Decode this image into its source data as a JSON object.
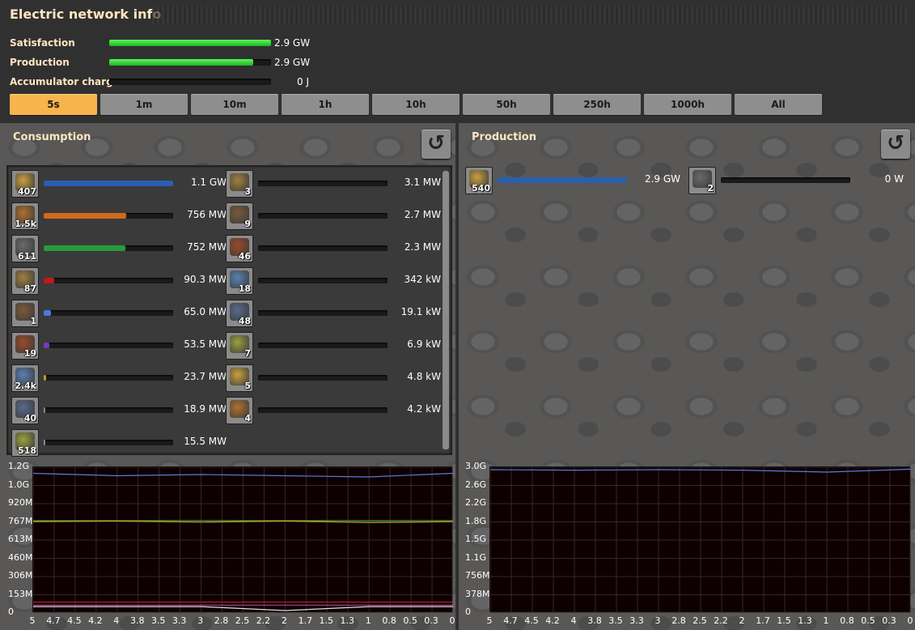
{
  "window": {
    "title": "Electric network info"
  },
  "stats": [
    {
      "label": "Satisfaction",
      "value": "2.9 GW",
      "fill": 1.0
    },
    {
      "label": "Production",
      "value": "2.9 GW",
      "fill": 0.89
    },
    {
      "label": "Accumulator charge",
      "value": "0 J",
      "fill": 0
    }
  ],
  "time_buttons": [
    {
      "label": "5s",
      "active": true
    },
    {
      "label": "1m",
      "active": false
    },
    {
      "label": "10m",
      "active": false
    },
    {
      "label": "1h",
      "active": false
    },
    {
      "label": "10h",
      "active": false
    },
    {
      "label": "50h",
      "active": false
    },
    {
      "label": "250h",
      "active": false
    },
    {
      "label": "1000h",
      "active": false
    },
    {
      "label": "All",
      "active": false
    }
  ],
  "consumption": {
    "title": "Consumption",
    "entries_left": [
      {
        "icon": "assembling-machine-icon",
        "count": "407",
        "value": "1.1 GW",
        "fill": 1.0,
        "color": "#2a5fb0"
      },
      {
        "icon": "electric-mining-drill-icon",
        "count": "1.5k",
        "value": "756 MW",
        "fill": 0.64,
        "color": "#d06a1a"
      },
      {
        "icon": "oil-refinery-icon",
        "count": "611",
        "value": "752 MW",
        "fill": 0.63,
        "color": "#2a9a3a"
      },
      {
        "icon": "chemical-plant-icon",
        "count": "87",
        "value": "90.3 MW",
        "fill": 0.08,
        "color": "#c0181c"
      },
      {
        "icon": "electric-furnace-icon",
        "count": "1",
        "value": "65.0 MW",
        "fill": 0.055,
        "color": "#4a7ad8"
      },
      {
        "icon": "pumpjack-icon",
        "count": "19",
        "value": "53.5 MW",
        "fill": 0.045,
        "color": "#7a3ab8"
      },
      {
        "icon": "inserter-icon",
        "count": "2.4k",
        "value": "23.7 MW",
        "fill": 0.02,
        "color": "#b8a020"
      },
      {
        "icon": "lab-icon",
        "count": "40",
        "value": "18.9 MW",
        "fill": 0.015,
        "color": "#888888"
      },
      {
        "icon": "fast-inserter-icon",
        "count": "518",
        "value": "15.5 MW",
        "fill": 0.013,
        "color": "#888888"
      }
    ],
    "entries_right": [
      {
        "icon": "centrifuge-icon",
        "count": "3",
        "value": "3.1 MW",
        "fill": 0,
        "color": "#888888"
      },
      {
        "icon": "radar-icon",
        "count": "9",
        "value": "2.7 MW",
        "fill": 0,
        "color": "#888888"
      },
      {
        "icon": "roboport-icon",
        "count": "46",
        "value": "2.3 MW",
        "fill": 0,
        "color": "#888888"
      },
      {
        "icon": "filter-inserter-icon",
        "count": "18",
        "value": "342 kW",
        "fill": 0,
        "color": "#888888"
      },
      {
        "icon": "long-inserter-icon",
        "count": "48",
        "value": "19.1 kW",
        "fill": 0,
        "color": "#888888"
      },
      {
        "icon": "beacon-icon",
        "count": "7",
        "value": "6.9 kW",
        "fill": 0,
        "color": "#888888"
      },
      {
        "icon": "pump-icon",
        "count": "5",
        "value": "4.8 kW",
        "fill": 0,
        "color": "#888888"
      },
      {
        "icon": "stack-inserter-icon",
        "count": "4",
        "value": "4.2 kW",
        "fill": 0,
        "color": "#888888"
      }
    ]
  },
  "production": {
    "title": "Production",
    "entries": [
      {
        "icon": "steam-turbine-icon",
        "count": "540",
        "value": "2.9 GW",
        "fill": 1.0,
        "color": "#2a5fb0"
      },
      {
        "icon": "steam-engine-icon",
        "count": "2",
        "value": "0 W",
        "fill": 0,
        "color": "#888888"
      }
    ]
  },
  "chart_data": [
    {
      "type": "line",
      "y_tick_labels": [
        "1.2G",
        "1.0G",
        "920M",
        "767M",
        "613M",
        "460M",
        "306M",
        "153M",
        "0"
      ],
      "x_tick_labels": [
        "5",
        "4.7",
        "4.5",
        "4.2",
        "4",
        "3.8",
        "3.5",
        "3.3",
        "3",
        "2.8",
        "2.5",
        "2.2",
        "2",
        "1.7",
        "1.5",
        "1.3",
        "1",
        "0.8",
        "0.5",
        "0.3",
        "0"
      ],
      "ylim": [
        0,
        1200000000
      ],
      "x": [
        5,
        4,
        3,
        2,
        1,
        0
      ],
      "series": [
        {
          "values": [
            1150000000,
            1130000000,
            1140000000,
            1130000000,
            1120000000,
            1150000000
          ],
          "color": "#5a7ad8"
        },
        {
          "values": [
            760000000,
            760000000,
            760000000,
            760000000,
            760000000,
            760000000
          ],
          "color": "#3aa04a"
        },
        {
          "values": [
            752000000,
            758000000,
            748000000,
            758000000,
            745000000,
            752000000
          ],
          "color": "#c8a020"
        },
        {
          "values": [
            90000000,
            90000000,
            90000000,
            90000000,
            90000000,
            90000000
          ],
          "color": "#c0181c"
        },
        {
          "values": [
            65000000,
            65000000,
            65000000,
            65000000,
            65000000,
            65000000
          ],
          "color": "#b040b0"
        },
        {
          "values": [
            53000000,
            53000000,
            53000000,
            20000000,
            53000000,
            53000000
          ],
          "color": "#e0e0e0"
        }
      ]
    },
    {
      "type": "line",
      "y_tick_labels": [
        "3.0G",
        "2.6G",
        "2.2G",
        "1.8G",
        "1.5G",
        "1.1G",
        "756M",
        "378M",
        "0"
      ],
      "x_tick_labels": [
        "5",
        "4.7",
        "4.5",
        "4.2",
        "4",
        "3.8",
        "3.5",
        "3.3",
        "3",
        "2.8",
        "2.5",
        "2.2",
        "2",
        "1.7",
        "1.5",
        "1.3",
        "1",
        "0.8",
        "0.5",
        "0.3",
        "0"
      ],
      "ylim": [
        0,
        3000000000
      ],
      "x": [
        5,
        4,
        3,
        2,
        1,
        0
      ],
      "series": [
        {
          "values": [
            2950000000,
            2940000000,
            2950000000,
            2940000000,
            2900000000,
            2960000000
          ],
          "color": "#5a7ad8"
        }
      ]
    }
  ]
}
